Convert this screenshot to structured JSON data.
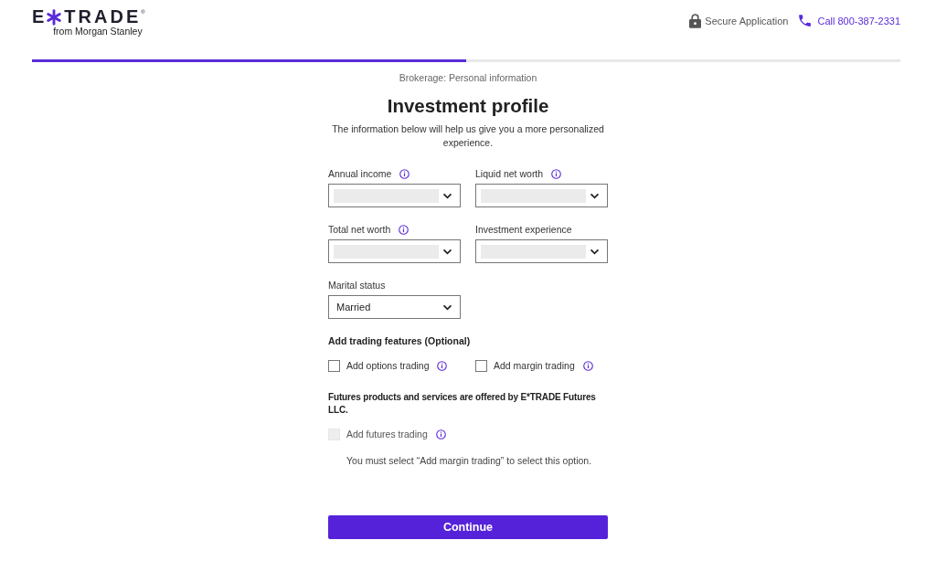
{
  "header": {
    "logo": {
      "wordmark_start": "E",
      "wordmark_end": "TRADE",
      "registered_mark": "®",
      "tagline": "from Morgan Stanley"
    },
    "secure_label": "Secure Application",
    "phone_link": "Call 800-387-2331"
  },
  "progress": {
    "level": 0.5
  },
  "step_label": "Brokerage: Personal information",
  "title": "Investment profile",
  "description": "The information below will help us give you a more personalized experience.",
  "fields": [
    {
      "label": "Annual income",
      "info": true,
      "redacted": true
    },
    {
      "label": "Liquid net worth",
      "info": true,
      "redacted": true
    },
    {
      "label": "Total net worth",
      "info": true,
      "redacted": true
    },
    {
      "label": "Investment experience",
      "info": false,
      "redacted": true
    },
    {
      "label": "Marital status",
      "info": false,
      "redacted": false,
      "value": "Married"
    }
  ],
  "trading_features": {
    "heading": "Add trading features (Optional)",
    "options": [
      {
        "label": "Add options trading",
        "checked": false,
        "disabled": false,
        "info": true
      },
      {
        "label": "Add margin trading",
        "checked": false,
        "disabled": false,
        "info": true
      }
    ]
  },
  "futures": {
    "notice": "Futures products and services are offered by E*TRADE Futures LLC.",
    "options": [
      {
        "label": "Add futures trading",
        "checked": false,
        "disabled": true,
        "info": true
      }
    ],
    "hint": "You must select “Add margin trading” to select this option."
  },
  "continue_button": "Continue"
}
